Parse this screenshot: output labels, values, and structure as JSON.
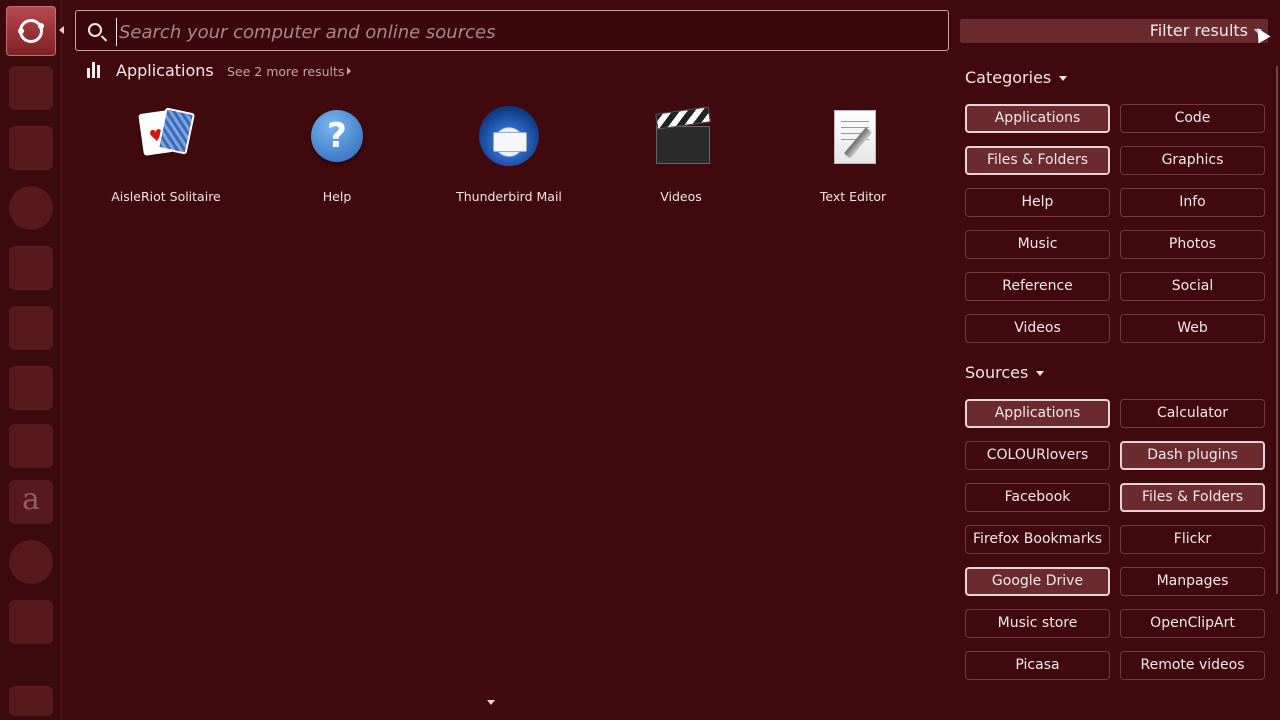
{
  "search": {
    "placeholder": "Search your computer and online sources",
    "value": ""
  },
  "results": {
    "heading": "Applications",
    "more_link": "See 2 more results",
    "apps": [
      {
        "label": "AisleRiot Solitaire",
        "icon": "solitaire-icon"
      },
      {
        "label": "Help",
        "icon": "help-icon"
      },
      {
        "label": "Thunderbird Mail",
        "icon": "thunderbird-icon"
      },
      {
        "label": "Videos",
        "icon": "videos-icon"
      },
      {
        "label": "Text Editor",
        "icon": "text-editor-icon"
      }
    ]
  },
  "filter": {
    "label": "Filter results",
    "categories_title": "Categories",
    "categories": [
      {
        "label": "Applications",
        "active": true
      },
      {
        "label": "Code",
        "active": false
      },
      {
        "label": "Files & Folders",
        "active": true
      },
      {
        "label": "Graphics",
        "active": false
      },
      {
        "label": "Help",
        "active": false
      },
      {
        "label": "Info",
        "active": false
      },
      {
        "label": "Music",
        "active": false
      },
      {
        "label": "Photos",
        "active": false
      },
      {
        "label": "Reference",
        "active": false
      },
      {
        "label": "Social",
        "active": false
      },
      {
        "label": "Videos",
        "active": false
      },
      {
        "label": "Web",
        "active": false
      }
    ],
    "sources_title": "Sources",
    "sources": [
      {
        "label": "Applications",
        "active": true
      },
      {
        "label": "Calculator",
        "active": false
      },
      {
        "label": "COLOURlovers",
        "active": false
      },
      {
        "label": "Dash plugins",
        "active": true
      },
      {
        "label": "Facebook",
        "active": false
      },
      {
        "label": "Files & Folders",
        "active": true
      },
      {
        "label": "Firefox Bookmarks",
        "active": false
      },
      {
        "label": "Flickr",
        "active": false
      },
      {
        "label": "Google Drive",
        "active": true
      },
      {
        "label": "Manpages",
        "active": false
      },
      {
        "label": "Music store",
        "active": false
      },
      {
        "label": "OpenClipArt",
        "active": false
      },
      {
        "label": "Picasa",
        "active": false
      },
      {
        "label": "Remote videos",
        "active": false
      }
    ]
  },
  "launcher": {
    "items": [
      "dash-home-icon",
      "files-icon",
      "browser-icon",
      "app-icon",
      "writer-icon",
      "calc-icon",
      "impress-icon",
      "software-center-icon",
      "amazon-icon",
      "settings-icon",
      "workspaces-icon",
      "trash-icon"
    ]
  },
  "colors": {
    "background": "#3f090d",
    "accent": "#6a2a2e",
    "text": "#f1e6e6"
  }
}
